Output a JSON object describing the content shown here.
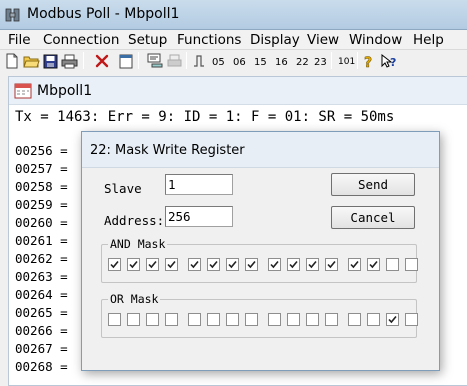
{
  "window": {
    "title": "Modbus Poll - Mbpoll1"
  },
  "menu": [
    "File",
    "Connection",
    "Setup",
    "Functions",
    "Display",
    "View",
    "Window",
    "Help"
  ],
  "toolbar": {
    "function_codes": [
      "05",
      "06",
      "15",
      "16",
      "22",
      "23"
    ],
    "read_write_code": "101",
    "icons": [
      "new-icon",
      "open-icon",
      "save-icon",
      "print-icon",
      "disconnect-icon",
      "window-icon",
      "read-write-definition-icon",
      "print-disabled-icon",
      "pulse-icon",
      "help-icon",
      "context-help-icon"
    ]
  },
  "child": {
    "title": "Mbpoll1",
    "status_line": "Tx = 1463: Err = 9: ID = 1: F = 01: SR = 50ms",
    "rows": [
      {
        "addr": "00256",
        "sep": " ="
      },
      {
        "addr": "00257",
        "sep": " ="
      },
      {
        "addr": "00258",
        "sep": " ="
      },
      {
        "addr": "00259",
        "sep": " ="
      },
      {
        "addr": "00260",
        "sep": " ="
      },
      {
        "addr": "00261",
        "sep": " ="
      },
      {
        "addr": "00262",
        "sep": " ="
      },
      {
        "addr": "00263",
        "sep": " ="
      },
      {
        "addr": "00264",
        "sep": " ="
      },
      {
        "addr": "00265",
        "sep": " ="
      },
      {
        "addr": "00266",
        "sep": " ="
      },
      {
        "addr": "00267",
        "sep": " ="
      },
      {
        "addr": "00268",
        "sep": " ="
      }
    ]
  },
  "dialog": {
    "title": "22: Mask Write Register",
    "slave_label": "Slave",
    "slave_value": "1",
    "address_label": "Address:",
    "address_value": "256",
    "send_label": "Send",
    "cancel_label": "Cancel",
    "and_mask": {
      "label": "AND Mask",
      "bits": [
        true,
        true,
        true,
        true,
        true,
        true,
        true,
        true,
        true,
        true,
        true,
        true,
        true,
        true,
        false,
        false
      ]
    },
    "or_mask": {
      "label": "OR Mask",
      "bits": [
        false,
        false,
        false,
        false,
        false,
        false,
        false,
        false,
        false,
        false,
        false,
        false,
        false,
        false,
        true,
        false
      ]
    }
  }
}
